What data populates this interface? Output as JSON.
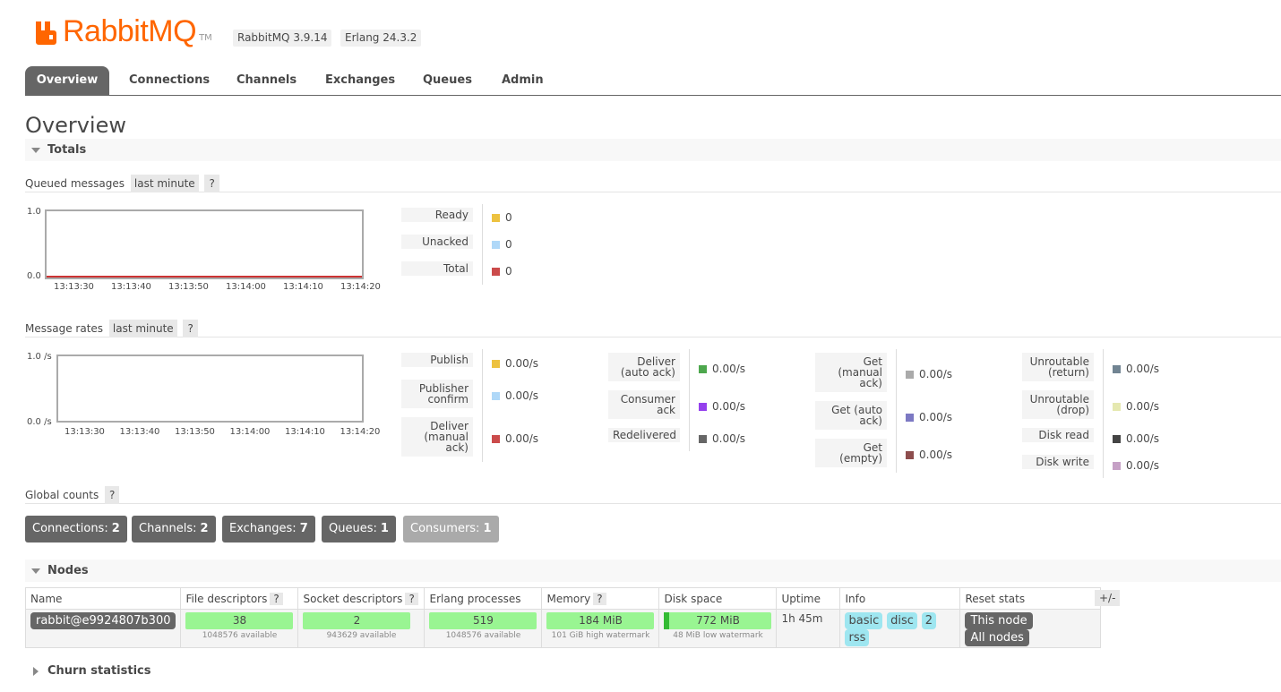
{
  "header": {
    "logo_text": "RabbitMQ",
    "logo_tm": "TM",
    "rabbitmq_version": "RabbitMQ 3.9.14",
    "erlang_version": "Erlang 24.3.2",
    "brand_color": "#ff6600"
  },
  "tabs": [
    {
      "label": "Overview",
      "active": true
    },
    {
      "label": "Connections"
    },
    {
      "label": "Channels"
    },
    {
      "label": "Exchanges"
    },
    {
      "label": "Queues"
    },
    {
      "label": "Admin"
    }
  ],
  "page_title": "Overview",
  "totals": {
    "heading": "Totals",
    "queued": {
      "label": "Queued messages",
      "range": "last minute",
      "help": "?",
      "y_top": "1.0",
      "y_bottom": "0.0",
      "x_ticks": [
        "13:13:30",
        "13:13:40",
        "13:13:50",
        "13:14:00",
        "13:14:10",
        "13:14:20"
      ],
      "legend": [
        {
          "label": "Ready",
          "value": "0",
          "color": "#edc240"
        },
        {
          "label": "Unacked",
          "value": "0",
          "color": "#afd8f8"
        },
        {
          "label": "Total",
          "value": "0",
          "color": "#cb4b4b"
        }
      ]
    },
    "rates": {
      "label": "Message rates",
      "range": "last minute",
      "help": "?",
      "y_top": "1.0 /s",
      "y_bottom": "0.0 /s",
      "x_ticks": [
        "13:13:30",
        "13:13:40",
        "13:13:50",
        "13:14:00",
        "13:14:10",
        "13:14:20"
      ],
      "col1": [
        {
          "label": "Publish",
          "value": "0.00/s",
          "color": "#edc240"
        },
        {
          "label": "Publisher confirm",
          "value": "0.00/s",
          "color": "#afd8f8"
        },
        {
          "label": "Deliver (manual ack)",
          "value": "0.00/s",
          "color": "#cb4b4b"
        }
      ],
      "col2": [
        {
          "label": "Deliver (auto ack)",
          "value": "0.00/s",
          "color": "#4da74d"
        },
        {
          "label": "Consumer ack",
          "value": "0.00/s",
          "color": "#9440ed"
        },
        {
          "label": "Redelivered",
          "value": "0.00/s",
          "color": "#666666"
        }
      ],
      "col3": [
        {
          "label": "Get (manual ack)",
          "value": "0.00/s",
          "color": "#aaaaaa"
        },
        {
          "label": "Get (auto ack)",
          "value": "0.00/s",
          "color": "#7c79c3"
        },
        {
          "label": "Get (empty)",
          "value": "0.00/s",
          "color": "#8d4d4d"
        }
      ],
      "col4": [
        {
          "label": "Unroutable (return)",
          "value": "0.00/s",
          "color": "#718492"
        },
        {
          "label": "Unroutable (drop)",
          "value": "0.00/s",
          "color": "#e5e8b0"
        },
        {
          "label": "Disk read",
          "value": "0.00/s",
          "color": "#444444"
        },
        {
          "label": "Disk write",
          "value": "0.00/s",
          "color": "#c5a0c5"
        }
      ]
    },
    "global": {
      "label": "Global counts",
      "help": "?",
      "counts": [
        {
          "label": "Connections:",
          "value": "2"
        },
        {
          "label": "Channels:",
          "value": "2"
        },
        {
          "label": "Exchanges:",
          "value": "7"
        },
        {
          "label": "Queues:",
          "value": "1"
        },
        {
          "label": "Consumers:",
          "value": "1"
        }
      ]
    }
  },
  "nodes": {
    "heading": "Nodes",
    "plus_minus": "+/-",
    "help": "?",
    "columns": {
      "name": "Name",
      "fd": "File descriptors",
      "sockets": "Socket descriptors",
      "procs": "Erlang processes",
      "memory": "Memory",
      "disk": "Disk space",
      "uptime": "Uptime",
      "info": "Info",
      "reset": "Reset stats"
    },
    "row": {
      "name": "rabbit@e9924807b300",
      "fd": "38",
      "fd_sub": "1048576 available",
      "sockets": "2",
      "sockets_sub": "943629 available",
      "procs": "519",
      "procs_sub": "1048576 available",
      "memory": "184 MiB",
      "memory_sub": "101 GiB high watermark",
      "disk": "772 MiB",
      "disk_sub": "48 MiB low watermark",
      "uptime": "1h 45m",
      "info_tags": [
        "basic",
        "disc",
        "2",
        "rss"
      ],
      "reset_this": "This node",
      "reset_all": "All nodes"
    }
  },
  "churn": {
    "heading": "Churn statistics"
  }
}
